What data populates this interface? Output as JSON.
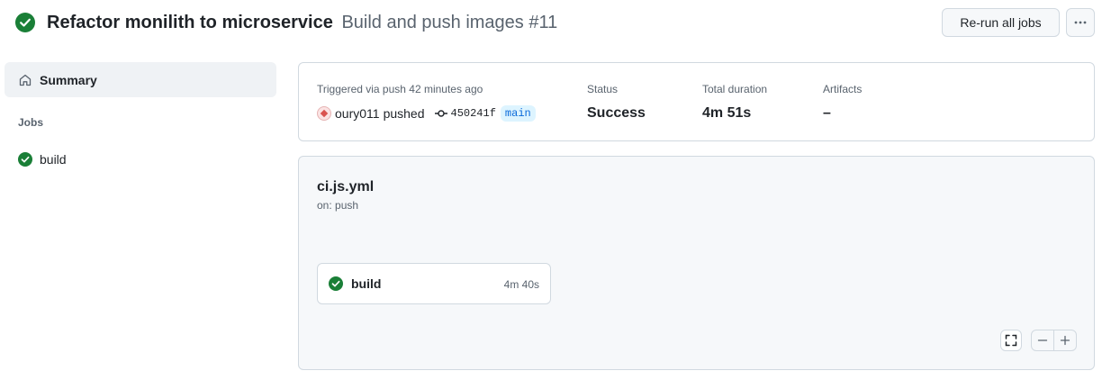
{
  "colors": {
    "success": "#1a7f37",
    "muted": "#59636e",
    "border": "#d1d9e0",
    "accent": "#0969da"
  },
  "header": {
    "status_icon": "check-circle-fill-icon",
    "run_title": "Refactor monilith to microservice",
    "workflow_title": "Build and push images #11",
    "rerun_label": "Re-run all jobs",
    "more_icon": "kebab-horizontal-icon"
  },
  "sidebar": {
    "summary_icon": "home-icon",
    "summary_label": "Summary",
    "jobs_heading": "Jobs",
    "jobs": [
      {
        "label": "build",
        "status_icon": "check-circle-fill-icon"
      }
    ]
  },
  "summary": {
    "trigger_label": "Triggered via push 42 minutes ago",
    "actor": "oury011",
    "action": "pushed",
    "commit_icon": "git-commit-icon",
    "commit_sha": "450241f",
    "branch": "main",
    "status_label": "Status",
    "status_value": "Success",
    "duration_label": "Total duration",
    "duration_value": "4m 51s",
    "artifacts_label": "Artifacts",
    "artifacts_value": "–"
  },
  "workflow": {
    "file_name": "ci.js.yml",
    "trigger": "on: push",
    "jobs": [
      {
        "label": "build",
        "duration": "4m 40s",
        "status_icon": "check-circle-fill-icon"
      }
    ],
    "controls": {
      "fullscreen_icon": "screen-full-icon",
      "zoom_out_icon": "dash-icon",
      "zoom_in_icon": "plus-icon"
    }
  }
}
